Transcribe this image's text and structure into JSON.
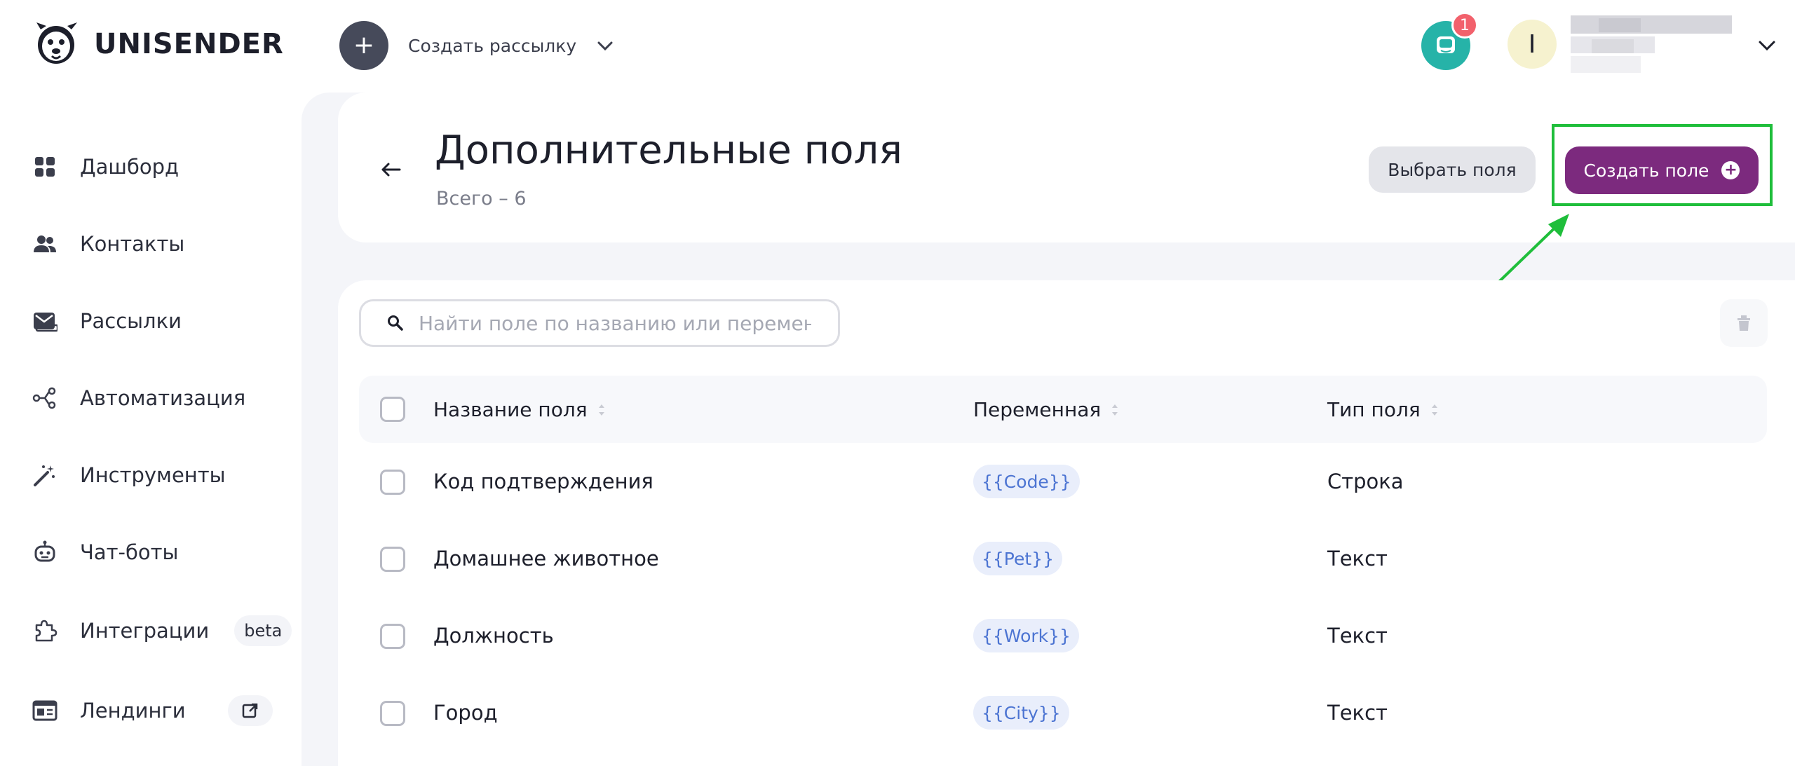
{
  "brand": {
    "name": "UNISENDER"
  },
  "header": {
    "create_label": "Создать рассылку",
    "chat_badge": "1",
    "avatar_letter": "I"
  },
  "sidebar": {
    "items": [
      {
        "label": "Дашборд",
        "icon": "dashboard-icon"
      },
      {
        "label": "Контакты",
        "icon": "contacts-icon"
      },
      {
        "label": "Рассылки",
        "icon": "mail-icon"
      },
      {
        "label": "Автоматизация",
        "icon": "automation-icon"
      },
      {
        "label": "Инструменты",
        "icon": "magic-wand-icon"
      },
      {
        "label": "Чат-боты",
        "icon": "bot-icon"
      },
      {
        "label": "Интеграции",
        "icon": "puzzle-icon",
        "tag": "beta"
      },
      {
        "label": "Лендинги",
        "icon": "landing-icon",
        "tag_icon": "external-link-icon"
      }
    ]
  },
  "page": {
    "title": "Дополнительные поля",
    "subtitle": "Всего – 6",
    "select_fields_label": "Выбрать поля",
    "create_field_label": "Создать поле"
  },
  "search": {
    "placeholder": "Найти поле по названию или переменной"
  },
  "table": {
    "columns": [
      "Название поля",
      "Переменная",
      "Тип поля"
    ],
    "rows": [
      {
        "name": "Код подтверждения",
        "variable": "{{Code}}",
        "type": "Строка"
      },
      {
        "name": "Домашнее животное",
        "variable": "{{Pet}}",
        "type": "Текст"
      },
      {
        "name": "Должность",
        "variable": "{{Work}}",
        "type": "Текст"
      },
      {
        "name": "Город",
        "variable": "{{City}}",
        "type": "Текст"
      }
    ]
  },
  "colors": {
    "accent": "#7c2a7e",
    "highlight": "#1fbe3b",
    "chat": "#26b3a8",
    "badge": "#f2616c",
    "variable_text": "#4c74d2"
  }
}
